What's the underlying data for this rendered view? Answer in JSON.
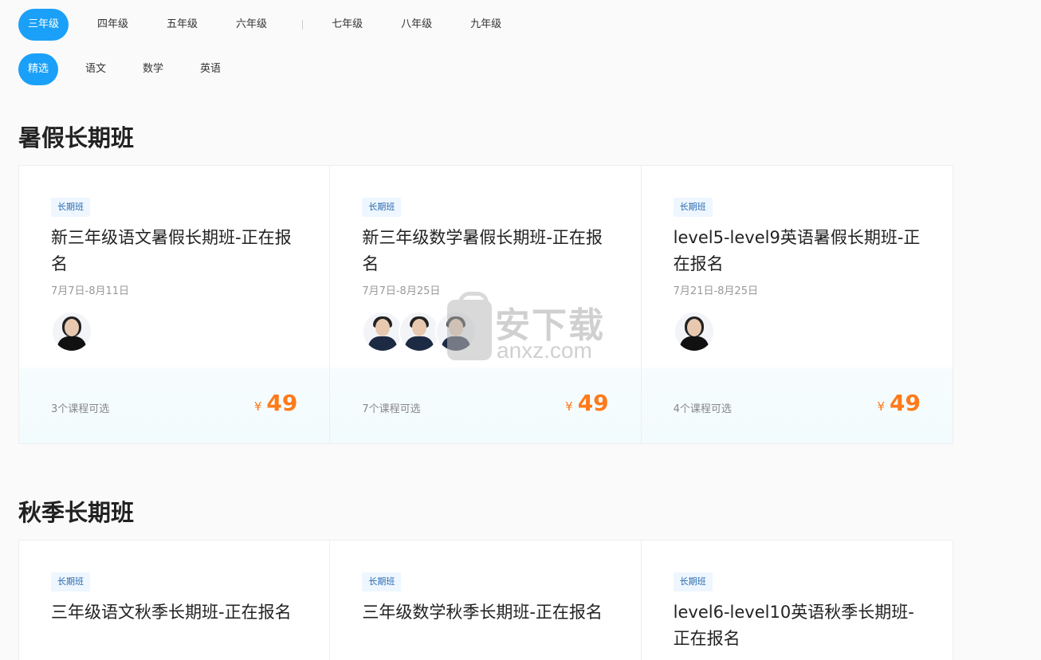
{
  "grades": {
    "items": [
      "三年级",
      "四年级",
      "五年级",
      "六年级",
      "七年级",
      "八年级",
      "九年级"
    ],
    "active": "三年级"
  },
  "subjects": {
    "items": [
      "精选",
      "语文",
      "数学",
      "英语"
    ],
    "active": "精选"
  },
  "sections": [
    {
      "title": "暑假长期班",
      "cards": [
        {
          "tag": "长期班",
          "title": "新三年级语文暑假长期班-正在报名",
          "date": "7月7日-8月11日",
          "teachers": [
            "female"
          ],
          "courses": "3个课程可选",
          "currency": "¥",
          "price": "49"
        },
        {
          "tag": "长期班",
          "title": "新三年级数学暑假长期班-正在报名",
          "date": "7月7日-8月25日",
          "teachers": [
            "male",
            "male",
            "male"
          ],
          "courses": "7个课程可选",
          "currency": "¥",
          "price": "49"
        },
        {
          "tag": "长期班",
          "title": "level5-level9英语暑假长期班-正在报名",
          "date": "7月21日-8月25日",
          "teachers": [
            "female"
          ],
          "courses": "4个课程可选",
          "currency": "¥",
          "price": "49"
        }
      ]
    },
    {
      "title": "秋季长期班",
      "cards": [
        {
          "tag": "长期班",
          "title": "三年级语文秋季长期班-正在报名"
        },
        {
          "tag": "长期班",
          "title": "三年级数学秋季长期班-正在报名"
        },
        {
          "tag": "长期班",
          "title": "level6-level10英语秋季长期班-正在报名"
        }
      ]
    }
  ],
  "watermark": {
    "cn": "安下载",
    "en": "anxz.com"
  },
  "colors": {
    "accent": "#1aa0f8",
    "price": "#ff7a1a",
    "tag_bg": "#eef6ff",
    "tag_text": "#2b6cb0"
  }
}
